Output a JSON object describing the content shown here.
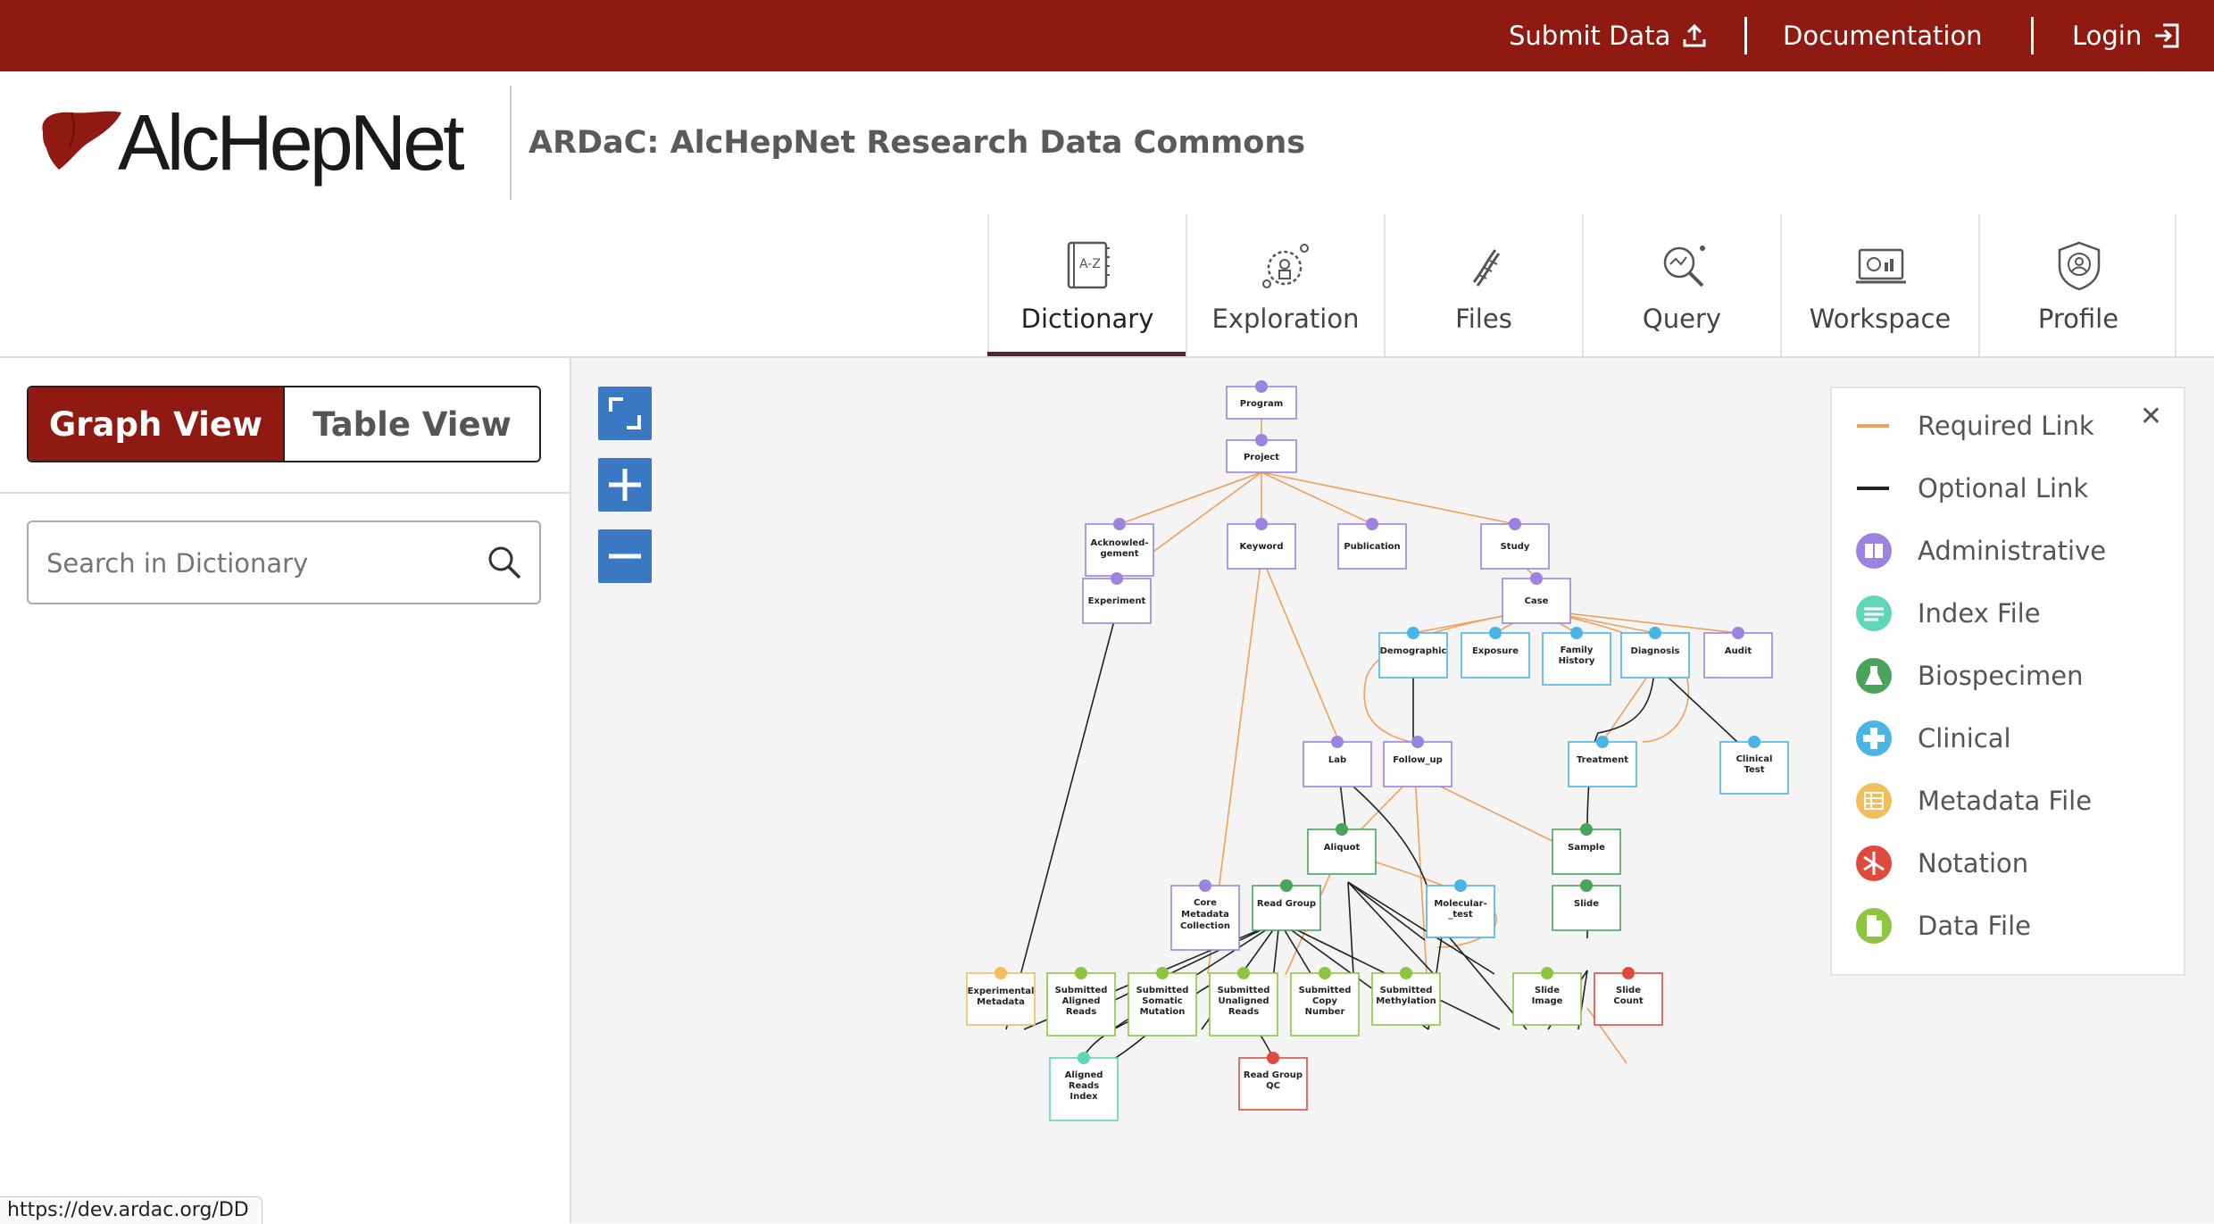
{
  "topbar": {
    "submit_label": "Submit Data",
    "docs_label": "Documentation",
    "login_label": "Login",
    "bg_color": "#8e1a12"
  },
  "header": {
    "logo_text": "AlcHepNet",
    "site_title": "ARDaC: AlcHepNet Research Data Commons"
  },
  "nav": {
    "tabs": [
      {
        "label": "Dictionary",
        "icon": "dictionary-icon"
      },
      {
        "label": "Exploration",
        "icon": "exploration-icon"
      },
      {
        "label": "Files",
        "icon": "files-icon"
      },
      {
        "label": "Query",
        "icon": "query-icon"
      },
      {
        "label": "Workspace",
        "icon": "workspace-icon"
      },
      {
        "label": "Profile",
        "icon": "profile-icon"
      }
    ],
    "active_tab": "Dictionary"
  },
  "sidebar": {
    "graph_view_label": "Graph View",
    "table_view_label": "Table View",
    "search_placeholder": "Search in Dictionary"
  },
  "status_bar": {
    "url": "https://dev.ardac.org/DD"
  },
  "legend": {
    "items": [
      {
        "label": "Required Link",
        "color": "#f0a05a"
      },
      {
        "label": "Optional Link",
        "color": "#222222"
      },
      {
        "label": "Administrative",
        "color": "#9b84e0"
      },
      {
        "label": "Index File",
        "color": "#5fd6b7"
      },
      {
        "label": "Biospecimen",
        "color": "#4aa35a"
      },
      {
        "label": "Clinical",
        "color": "#4ab3e8"
      },
      {
        "label": "Metadata File",
        "color": "#f2be5a"
      },
      {
        "label": "Notation",
        "color": "#e04a3e"
      },
      {
        "label": "Data File",
        "color": "#8cc63f"
      }
    ]
  },
  "graph": {
    "nodes": {
      "program": "Program",
      "project": "Project",
      "acknowledgement_1": "Acknowled-",
      "acknowledgement_2": "gement",
      "keyword": "Keyword",
      "publication": "Publication",
      "study": "Study",
      "experiment": "Experiment",
      "case": "Case",
      "demographic": "Demographic",
      "exposure": "Exposure",
      "family_history_1": "Family",
      "family_history_2": "History",
      "diagnosis": "Diagnosis",
      "audit": "Audit",
      "lab": "Lab",
      "follow_up": "Follow_up",
      "treatment": "Treatment",
      "clinical_test_1": "Clinical",
      "clinical_test_2": "Test",
      "aliquot": "Aliquot",
      "sample": "Sample",
      "core_metadata_1": "Core",
      "core_metadata_2": "Metadata",
      "core_metadata_3": "Collection",
      "read_group": "Read Group",
      "molecular_test_1": "Molecular-",
      "molecular_test_2": "_test",
      "slide": "Slide",
      "experimental_metadata_1": "Experimental",
      "experimental_metadata_2": "Metadata",
      "sub_aligned_1": "Submitted",
      "sub_aligned_2": "Aligned",
      "sub_aligned_3": "Reads",
      "sub_somatic_1": "Submitted",
      "sub_somatic_2": "Somatic",
      "sub_somatic_3": "Mutation",
      "sub_unaligned_1": "Submitted",
      "sub_unaligned_2": "Unaligned",
      "sub_unaligned_3": "Reads",
      "sub_copy_1": "Submitted",
      "sub_copy_2": "Copy",
      "sub_copy_3": "Number",
      "sub_methylation_1": "Submitted",
      "sub_methylation_2": "Methylation",
      "slide_image_1": "Slide",
      "slide_image_2": "Image",
      "slide_count_1": "Slide",
      "slide_count_2": "Count",
      "aligned_index_1": "Aligned",
      "aligned_index_2": "Reads",
      "aligned_index_3": "Index",
      "read_group_qc_1": "Read Group",
      "read_group_qc_2": "QC"
    }
  }
}
